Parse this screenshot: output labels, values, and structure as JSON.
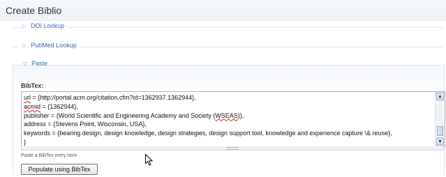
{
  "page": {
    "title": "Create Biblio"
  },
  "sections": [
    {
      "label": "DOI Lookup",
      "collapsed": true
    },
    {
      "label": "PubMed Lookup",
      "collapsed": true
    },
    {
      "label": "Paste",
      "collapsed": false
    }
  ],
  "bibtex": {
    "label": "BibTex:",
    "lines": [
      "url = {http://portal.acm.org/citation.cfm?id=1362937.1362944},",
      "acmid = {1362944},",
      "publisher = {World Scientific and Engineering Academy and Society (WSEAS)},",
      "address = {Stevens Point, Wisconsin, USA},",
      "keywords = {bearing design, design knowledge, design strategies, design support tool, knowledge and experience capture \\& reuse},",
      "}"
    ],
    "help": "Paste a BibTex entry here"
  },
  "button": {
    "label": "Populate using BibTex"
  }
}
